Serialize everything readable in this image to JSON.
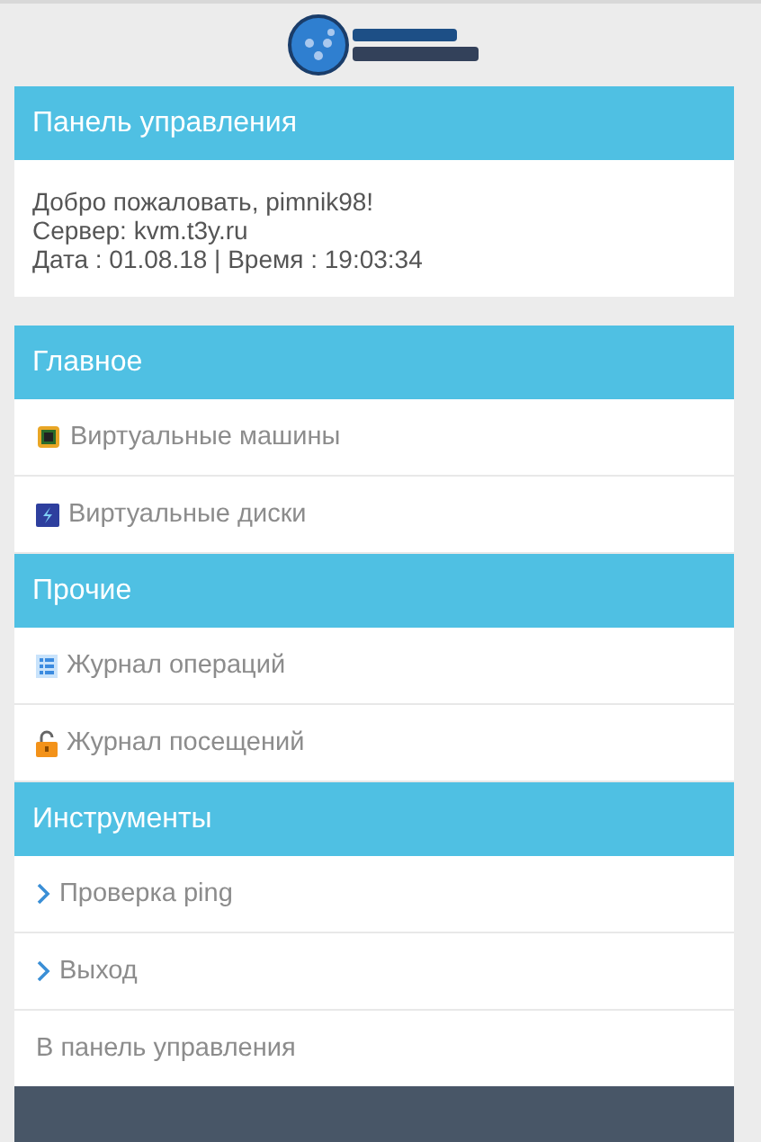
{
  "panel": {
    "title": "Панель управления",
    "lines": [
      "Добро пожаловать, pimnik98!",
      "Сервер: kvm.t3y.ru",
      "Дата : 01.08.18 | Время : 19:03:34"
    ]
  },
  "sections": [
    {
      "title": "Главное",
      "items": [
        {
          "label": "Виртуальные машины",
          "kind": "chip"
        },
        {
          "label": "Виртуальные диски",
          "kind": "disk"
        }
      ]
    },
    {
      "title": "Прочие",
      "items": [
        {
          "label": "Журнал операций",
          "kind": "list"
        },
        {
          "label": "Журнал посещений",
          "kind": "lock"
        }
      ]
    },
    {
      "title": "Инструменты",
      "items": [
        {
          "label": "Проверка ping",
          "kind": "link"
        },
        {
          "label": "Выход",
          "kind": "link"
        }
      ]
    }
  ],
  "back_link": "В панель управления"
}
